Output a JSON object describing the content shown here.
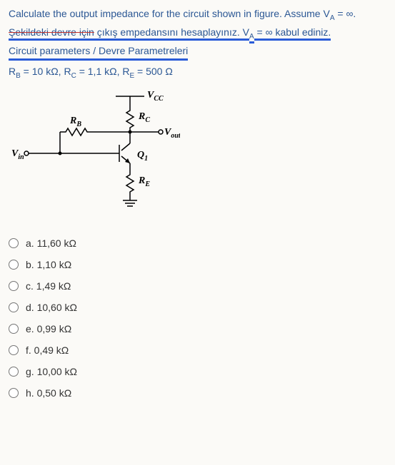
{
  "question": {
    "line1": "Calculate the output impedance for the circuit shown in figure. Assume V",
    "line1_sub": "A",
    "line1_tail": " = ∞.",
    "line2_a": "Şekildeki devre için",
    "line2_b": " çıkış empedansını hesaplayınız. V",
    "line2_sub": "A",
    "line2_c": " = ∞ kabul ediniz.",
    "line3": "Circuit parameters / Devre Parametreleri",
    "params_html": "R_B = 10 kΩ, R_C = 1,1 kΩ, R_E = 500 Ω"
  },
  "diagram": {
    "vcc": "V",
    "vcc_sub": "CC",
    "rb": "R",
    "rb_sub": "B",
    "rc": "R",
    "rc_sub": "C",
    "re": "R",
    "re_sub": "E",
    "vout": "V",
    "vout_sub": "out",
    "vin": "V",
    "vin_sub": "in",
    "q1": "Q",
    "q1_sub": "1"
  },
  "options": [
    {
      "key": "a",
      "text": "a. 11,60 kΩ"
    },
    {
      "key": "b",
      "text": "b. 1,10 kΩ"
    },
    {
      "key": "c",
      "text": "c. 1,49 kΩ"
    },
    {
      "key": "d",
      "text": "d. 10,60 kΩ"
    },
    {
      "key": "e",
      "text": "e. 0,99 kΩ"
    },
    {
      "key": "f",
      "text": "f. 0,49 kΩ"
    },
    {
      "key": "g",
      "text": "g. 10,00 kΩ"
    },
    {
      "key": "h",
      "text": "h. 0,50 kΩ"
    }
  ]
}
